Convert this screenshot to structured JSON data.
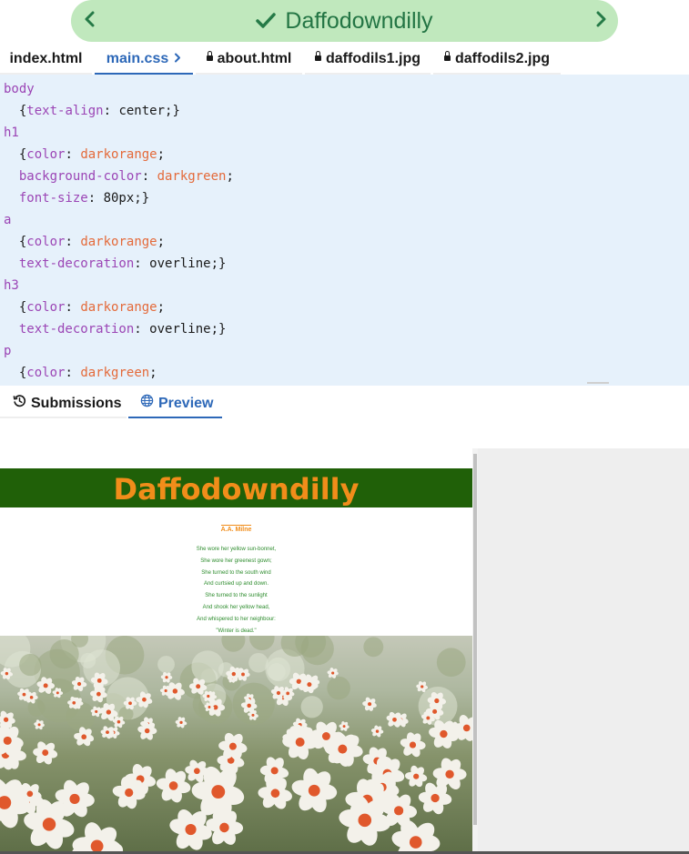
{
  "header": {
    "title": "Daffodowndilly",
    "prev_icon": "chevron-left-icon",
    "next_icon": "chevron-right-icon",
    "status_icon": "check-icon"
  },
  "files": [
    {
      "label": "index.html",
      "active": false,
      "locked": false
    },
    {
      "label": "main.css",
      "active": true,
      "locked": false
    },
    {
      "label": "about.html",
      "active": false,
      "locked": true
    },
    {
      "label": "daffodils1.jpg",
      "active": false,
      "locked": true
    },
    {
      "label": "daffodils2.jpg",
      "active": false,
      "locked": true
    }
  ],
  "code": [
    {
      "tokens": [
        {
          "t": "body",
          "c": "sel"
        }
      ]
    },
    {
      "tokens": [
        {
          "t": "  {",
          "c": "plain"
        },
        {
          "t": "text-align",
          "c": "prop"
        },
        {
          "t": ": center;}",
          "c": "plain"
        }
      ]
    },
    {
      "tokens": [
        {
          "t": "h1",
          "c": "sel"
        }
      ]
    },
    {
      "tokens": [
        {
          "t": "  {",
          "c": "plain"
        },
        {
          "t": "color",
          "c": "prop"
        },
        {
          "t": ": ",
          "c": "plain"
        },
        {
          "t": "darkorange",
          "c": "val"
        },
        {
          "t": ";",
          "c": "plain"
        }
      ]
    },
    {
      "tokens": [
        {
          "t": "  ",
          "c": "plain"
        },
        {
          "t": "background-color",
          "c": "prop"
        },
        {
          "t": ": ",
          "c": "plain"
        },
        {
          "t": "darkgreen",
          "c": "val"
        },
        {
          "t": ";",
          "c": "plain"
        }
      ]
    },
    {
      "tokens": [
        {
          "t": "  ",
          "c": "plain"
        },
        {
          "t": "font-size",
          "c": "prop"
        },
        {
          "t": ": 80px;}",
          "c": "plain"
        }
      ]
    },
    {
      "tokens": [
        {
          "t": "a",
          "c": "sel"
        }
      ]
    },
    {
      "tokens": [
        {
          "t": "  {",
          "c": "plain"
        },
        {
          "t": "color",
          "c": "prop"
        },
        {
          "t": ": ",
          "c": "plain"
        },
        {
          "t": "darkorange",
          "c": "val"
        },
        {
          "t": ";",
          "c": "plain"
        }
      ]
    },
    {
      "tokens": [
        {
          "t": "  ",
          "c": "plain"
        },
        {
          "t": "text-decoration",
          "c": "prop"
        },
        {
          "t": ": overline;}",
          "c": "plain"
        }
      ]
    },
    {
      "tokens": [
        {
          "t": "h3",
          "c": "sel"
        }
      ]
    },
    {
      "tokens": [
        {
          "t": "  {",
          "c": "plain"
        },
        {
          "t": "color",
          "c": "prop"
        },
        {
          "t": ": ",
          "c": "plain"
        },
        {
          "t": "darkorange",
          "c": "val"
        },
        {
          "t": ";",
          "c": "plain"
        }
      ]
    },
    {
      "tokens": [
        {
          "t": "  ",
          "c": "plain"
        },
        {
          "t": "text-decoration",
          "c": "prop"
        },
        {
          "t": ": overline;}",
          "c": "plain"
        }
      ]
    },
    {
      "tokens": [
        {
          "t": "p",
          "c": "sel"
        }
      ]
    },
    {
      "tokens": [
        {
          "t": "  {",
          "c": "plain"
        },
        {
          "t": "color",
          "c": "prop"
        },
        {
          "t": ": ",
          "c": "plain"
        },
        {
          "t": "darkgreen",
          "c": "val"
        },
        {
          "t": ";",
          "c": "plain"
        }
      ]
    }
  ],
  "bottom_tabs": {
    "submissions": {
      "label": "Submissions",
      "icon": "history-icon"
    },
    "preview": {
      "label": "Preview",
      "icon": "globe-icon"
    }
  },
  "preview": {
    "heading": "Daffodowndilly",
    "author": "A.A. Milne",
    "poem": [
      "She wore her yellow sun-bonnet,",
      "She wore her greenest gown;",
      "She turned to the south wind",
      "And curtsied up and down.",
      "She turned to the sunlight",
      "And shook her yellow head,",
      "And whispered to her neighbour:",
      "\"Winter is dead.\""
    ]
  },
  "colors": {
    "banner_bg": "#c0e8bd",
    "banner_text": "#237544",
    "active_tab": "#2d68b8",
    "editor_bg": "#e6f1fb",
    "selector": "#9b45b5",
    "value": "#e46a3a",
    "h1_bg": "#206008",
    "h1_text": "#f18d1a",
    "poem_text": "#2d8c2d"
  }
}
